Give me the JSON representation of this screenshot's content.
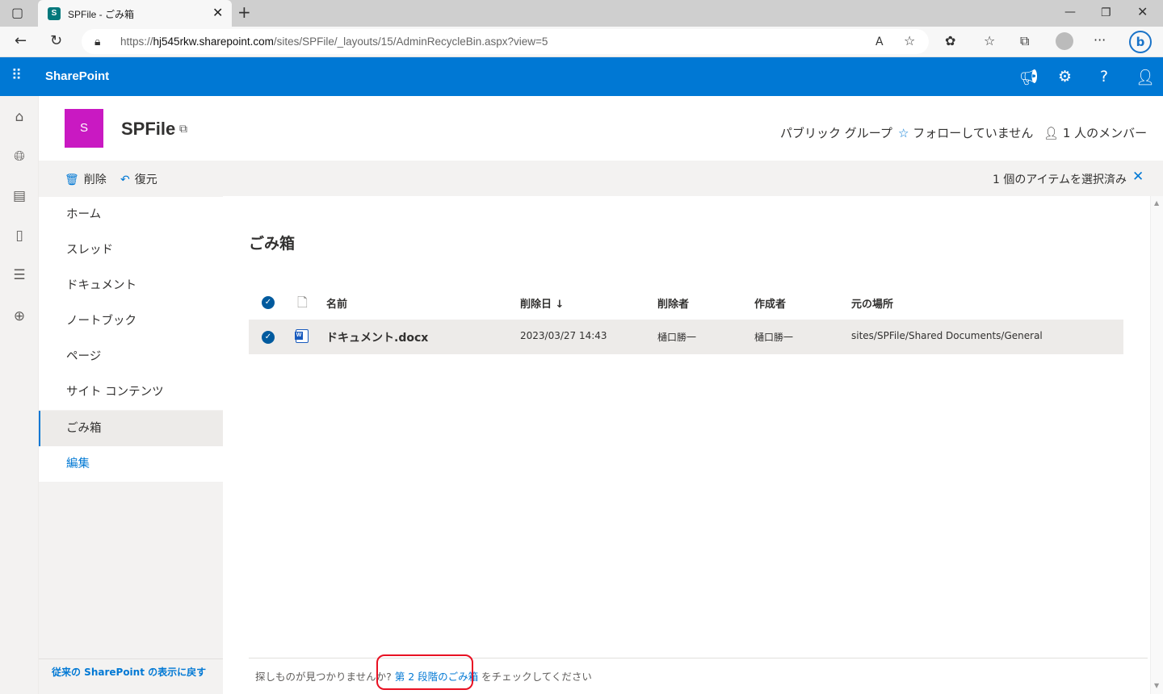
{
  "browser": {
    "tab_title": "SPFile - ごみ箱",
    "tab_favicon_letter": "S",
    "url_prefix": "https://",
    "url_host": "hj545rkw.sharepoint.com",
    "url_path": "/sites/SPFile/_layouts/15/AdminRecycleBin.aspx?view=5"
  },
  "suite": {
    "brand": "SharePoint"
  },
  "site": {
    "logo_letter": "S",
    "title": "SPFile",
    "group_type": "パブリック グループ",
    "follow_label": "フォローしていません",
    "members_label": "1 人のメンバー"
  },
  "commands": {
    "delete": "削除",
    "restore": "復元",
    "selection_status": "1 個のアイテムを選択済み"
  },
  "nav": {
    "items": [
      {
        "label": "ホーム"
      },
      {
        "label": "スレッド"
      },
      {
        "label": "ドキュメント"
      },
      {
        "label": "ノートブック"
      },
      {
        "label": "ページ"
      },
      {
        "label": "サイト コンテンツ"
      },
      {
        "label": "ごみ箱"
      },
      {
        "label": "編集"
      }
    ],
    "selected": "ごみ箱",
    "legacy_link": "従来の SharePoint の表示に戻す"
  },
  "main": {
    "title": "ごみ箱",
    "columns": {
      "name": "名前",
      "deleted_date": "削除日 ↓",
      "deleted_by": "削除者",
      "created_by": "作成者",
      "original_location": "元の場所"
    },
    "rows": [
      {
        "name": "ドキュメント.docx",
        "deleted_date": "2023/03/27 14:43",
        "deleted_by": "樋口勝一",
        "created_by": "樋口勝一",
        "original_location": "sites/SPFile/Shared Documents/General",
        "selected": true
      }
    ],
    "footer_pre": "探しものが見つかりませんか? ",
    "footer_link": "第 2 段階のごみ箱",
    "footer_post": " をチェックしてください"
  },
  "colors": {
    "accent": "#0078d4",
    "site_logo": "#c919c2",
    "highlight": "#e81123"
  }
}
